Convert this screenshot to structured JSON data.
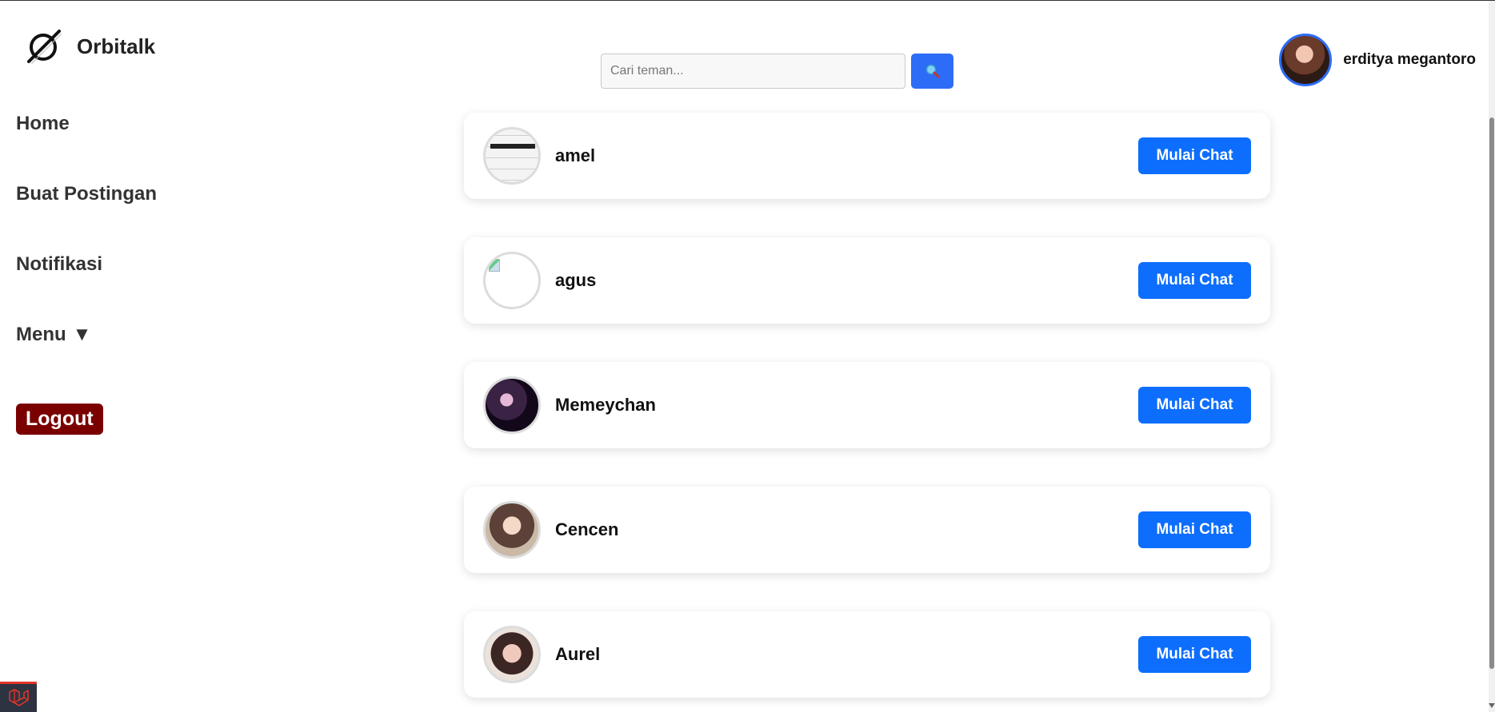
{
  "brand": {
    "name": "Orbitalk",
    "logo_icon": "orbit-logo-icon"
  },
  "search": {
    "placeholder": "Cari teman...",
    "value": "",
    "button_icon": "magnifier-icon"
  },
  "user": {
    "name": "erditya megantoro",
    "avatar_icon": "avatar"
  },
  "sidebar": {
    "items": [
      {
        "label": "Home"
      },
      {
        "label": "Buat Postingan"
      },
      {
        "label": "Notifikasi"
      },
      {
        "label": "Menu",
        "arrow": "▼"
      }
    ],
    "logout_label": "Logout"
  },
  "friends": [
    {
      "name": "amel",
      "button": "Mulai Chat"
    },
    {
      "name": "agus",
      "button": "Mulai Chat"
    },
    {
      "name": "Memeychan",
      "button": "Mulai Chat"
    },
    {
      "name": "Cencen",
      "button": "Mulai Chat"
    },
    {
      "name": "Aurel",
      "button": "Mulai Chat"
    }
  ],
  "colors": {
    "accent": "#0d6efd",
    "search_button": "#2d6cf6",
    "logout": "#7a0000",
    "text": "#222222"
  }
}
